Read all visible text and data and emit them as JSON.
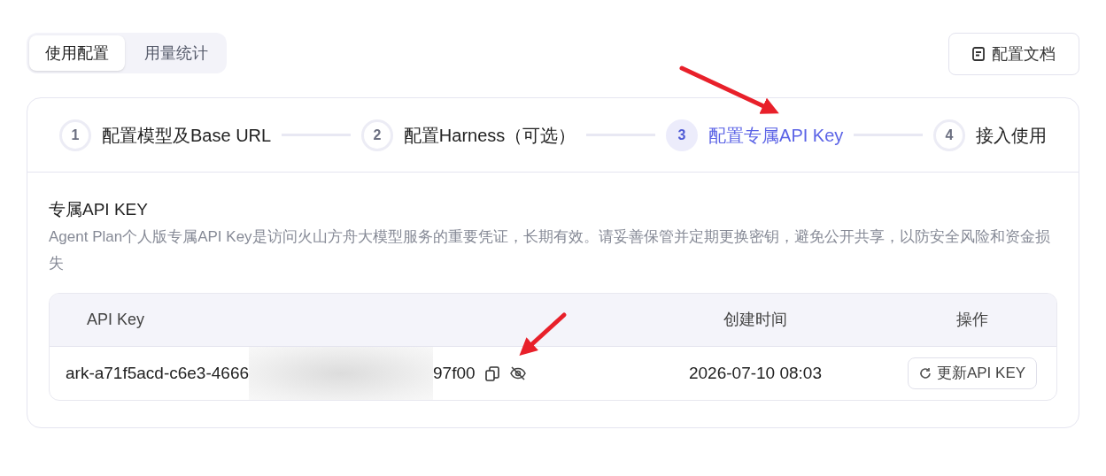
{
  "tabs": [
    {
      "label": "使用配置",
      "selected": true
    },
    {
      "label": "用量统计",
      "selected": false
    }
  ],
  "docs_button": "配置文档",
  "steps": [
    {
      "number": "1",
      "label": "配置模型及Base URL",
      "selected": false
    },
    {
      "number": "2",
      "label": "配置Harness（可选）",
      "selected": false
    },
    {
      "number": "3",
      "label": "配置专属API Key",
      "selected": true
    },
    {
      "number": "4",
      "label": "接入使用",
      "selected": false
    }
  ],
  "section": {
    "title": "专属API KEY",
    "description": "Agent Plan个人版专属API Key是访问火山方舟大模型服务的重要凭证，长期有效。请妥善保管并定期更换密钥，避免公开共享，以防安全风险和资金损失"
  },
  "table": {
    "columns": [
      "API Key",
      "创建时间",
      "操作"
    ],
    "rows": [
      {
        "key_start": "ark-a71f5acd-c6e3-4666",
        "key_end": "97f00",
        "created": "2026-07-10 08:03",
        "action": "更新API KEY"
      }
    ]
  }
}
